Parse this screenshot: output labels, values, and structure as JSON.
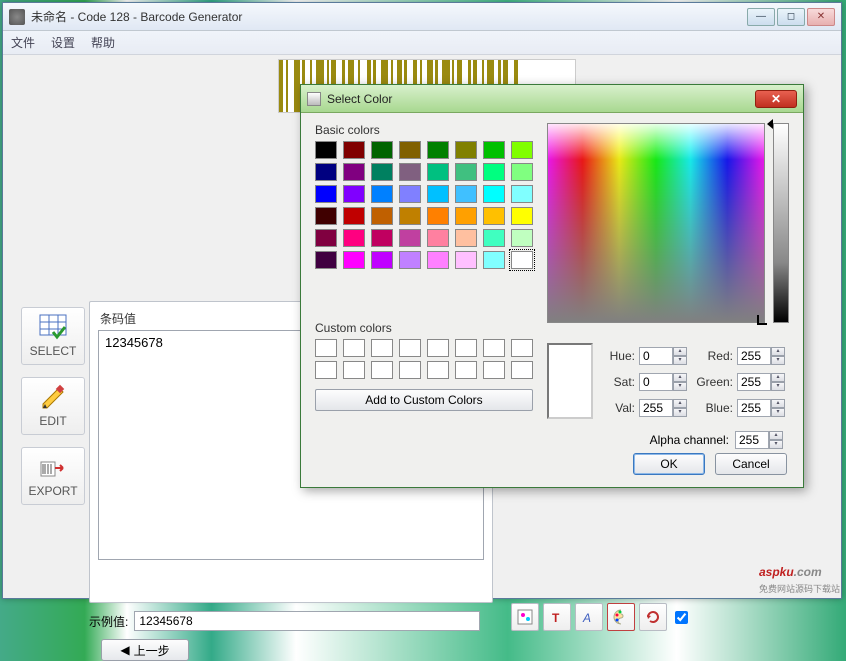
{
  "window": {
    "title": "未命名 - Code 128 - Barcode Generator"
  },
  "menubar": {
    "file": "文件",
    "settings": "设置",
    "help": "帮助"
  },
  "sidebar": {
    "select": "SELECT",
    "edit": "EDIT",
    "export": "EXPORT"
  },
  "panel": {
    "label": "条码值",
    "value": "12345678"
  },
  "example": {
    "label": "示例值:",
    "value": "12345678"
  },
  "nav": {
    "prev": "上一步"
  },
  "dialog": {
    "title": "Select Color",
    "basic_label": "Basic colors",
    "custom_label": "Custom colors",
    "add_custom": "Add to Custom Colors",
    "hue_label": "Hue:",
    "sat_label": "Sat:",
    "val_label": "Val:",
    "red_label": "Red:",
    "green_label": "Green:",
    "blue_label": "Blue:",
    "alpha_label": "Alpha channel:",
    "hue": "0",
    "sat": "0",
    "val": "255",
    "red": "255",
    "green": "255",
    "blue": "255",
    "alpha": "255",
    "ok": "OK",
    "cancel": "Cancel",
    "basic_colors": [
      "#000000",
      "#800000",
      "#006400",
      "#806000",
      "#008000",
      "#808000",
      "#00c000",
      "#80ff00",
      "#000080",
      "#800080",
      "#008060",
      "#806080",
      "#00c080",
      "#40c080",
      "#00ff80",
      "#80ff80",
      "#0000ff",
      "#8000ff",
      "#0080ff",
      "#8080ff",
      "#00c0ff",
      "#40c0ff",
      "#00ffff",
      "#80ffff",
      "#400000",
      "#c00000",
      "#c06000",
      "#c08000",
      "#ff8000",
      "#ffa000",
      "#ffc000",
      "#ffff00",
      "#800040",
      "#ff0080",
      "#c00060",
      "#c040a0",
      "#ff80a0",
      "#ffc0a0",
      "#40ffc0",
      "#c0ffc0",
      "#400040",
      "#ff00ff",
      "#c000ff",
      "#c080ff",
      "#ff80ff",
      "#ffc0ff",
      "#80ffff",
      "#ffffff"
    ]
  },
  "watermark": {
    "text": "aspku",
    "dom": ".com",
    "sub": "免费网站源码下载站"
  }
}
